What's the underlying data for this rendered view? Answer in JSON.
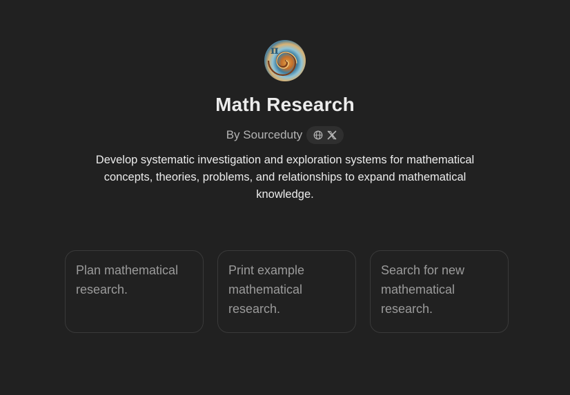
{
  "gpt": {
    "title": "Math Research",
    "author": "By Sourceduty",
    "links": [
      {
        "icon": "globe-icon"
      },
      {
        "icon": "x-logo-icon"
      }
    ],
    "description": "Develop systematic investigation and exploration systems for mathematical concepts, theories, problems, and relationships to expand mathematical knowledge."
  },
  "starters": [
    {
      "label": "Plan mathematical research."
    },
    {
      "label": "Print example mathematical research."
    },
    {
      "label": "Search for new mathematical research."
    }
  ],
  "colors": {
    "background": "#212121",
    "card_border": "#3a3a3a",
    "pill_background": "#2f2f2f",
    "muted_text": "#9b9b9b"
  }
}
